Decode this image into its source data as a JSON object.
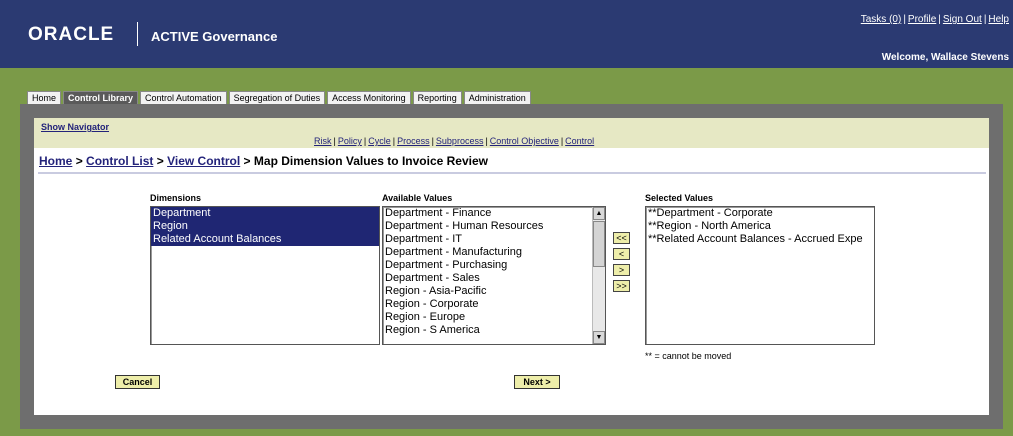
{
  "header": {
    "logo": "ORACLE",
    "product": "ACTIVE Governance",
    "links": [
      "Tasks (0)",
      "Profile",
      "Sign Out",
      "Help"
    ],
    "welcome": "Welcome, Wallace Stevens"
  },
  "tabs": [
    {
      "label": "Home",
      "active": false
    },
    {
      "label": "Control Library",
      "active": true
    },
    {
      "label": "Control Automation",
      "active": false
    },
    {
      "label": "Segregation of Duties",
      "active": false
    },
    {
      "label": "Access Monitoring",
      "active": false
    },
    {
      "label": "Reporting",
      "active": false
    },
    {
      "label": "Administration",
      "active": false
    }
  ],
  "navigator": {
    "show_label": "Show Navigator",
    "links": [
      "Risk",
      "Policy",
      "Cycle",
      "Process",
      "Subprocess",
      "Control Objective",
      "Control"
    ]
  },
  "breadcrumb": {
    "home": "Home",
    "control_list": "Control List",
    "view_control": "View Control",
    "current": "Map Dimension Values to Invoice Review",
    "separator": ">"
  },
  "dimensions": {
    "label": "Dimensions",
    "items": [
      "Department",
      "Region",
      "Related Account Balances"
    ]
  },
  "available": {
    "label": "Available Values",
    "items": [
      "Department - Finance",
      "Department - Human Resources",
      "Department - IT",
      "Department - Manufacturing",
      "Department - Purchasing",
      "Department - Sales",
      "Region - Asia-Pacific",
      "Region - Corporate",
      "Region - Europe",
      "Region - S America"
    ]
  },
  "selected": {
    "label": "Selected Values",
    "items": [
      "**Department - Corporate",
      "**Region - North America",
      "**Related Account Balances - Accrued Expe"
    ],
    "note": "** = cannot be moved"
  },
  "movers": {
    "remove_all": "<<",
    "remove": "<",
    "add": ">",
    "add_all": ">>"
  },
  "buttons": {
    "cancel": "Cancel",
    "next": "Next >"
  },
  "colors": {
    "header_bg": "#2b3a72",
    "band_bg": "#7b9a48",
    "selection": "#1f2673",
    "button_bg": "#eeeeaa"
  }
}
